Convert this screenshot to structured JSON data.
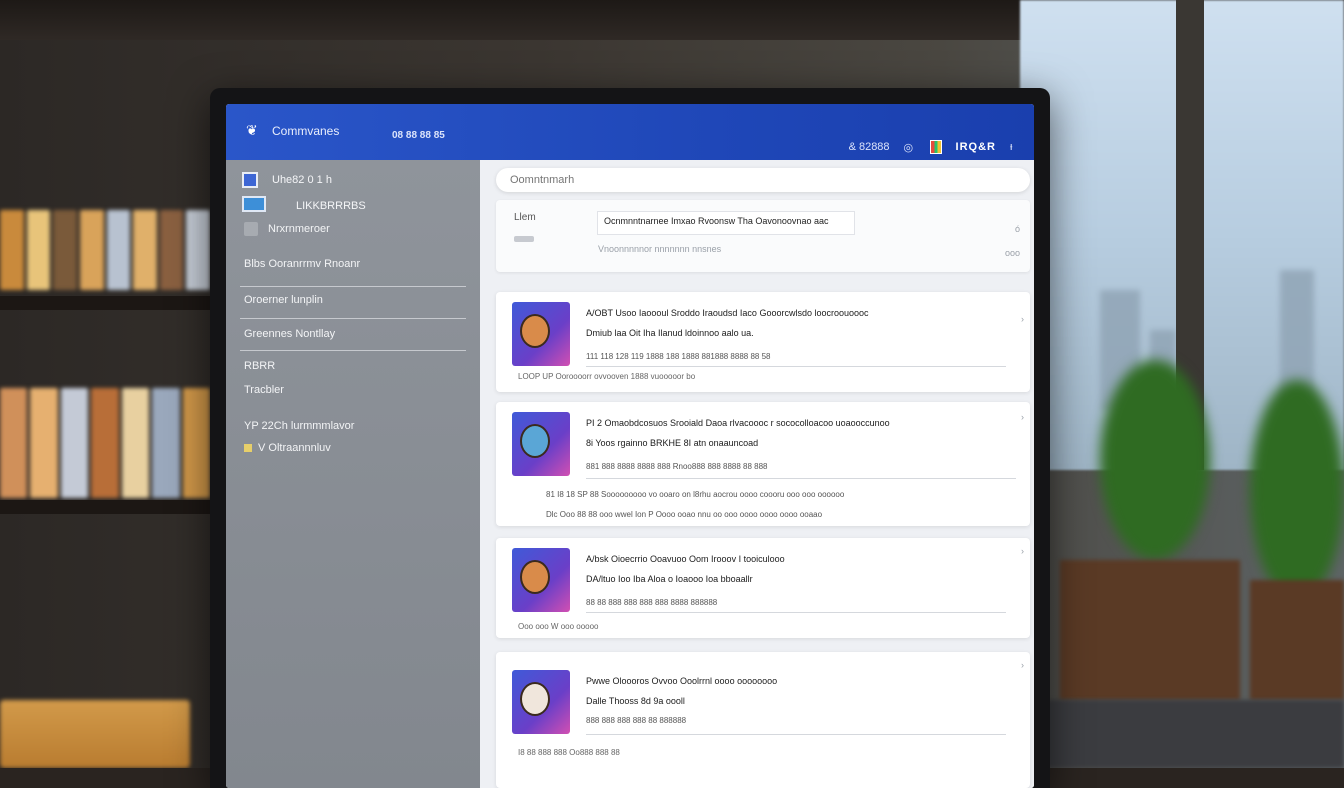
{
  "app": {
    "title": "Commvanes",
    "meta": "08 88 88 85",
    "user_label": "IRQ&R",
    "top_icon_text": "& 82888"
  },
  "sidebar": {
    "header": "Uhe82 0 1 h",
    "sub": "LIKKBRRRBS",
    "search_label": "Nrxrnmeroer",
    "items": [
      {
        "label": "Blbs      Ooranrrmv Rnoanr"
      },
      {
        "label": "Oroerner lunplin"
      },
      {
        "label": "Greennes Nontllay"
      },
      {
        "label": "RBRR"
      },
      {
        "label": "Tracbler"
      },
      {
        "label": "YP 22Ch lurmmmlavor"
      },
      {
        "label": "V Oltraannnluv"
      }
    ]
  },
  "main": {
    "search_placeholder": "Oomntnmarh",
    "compose": {
      "label": "Llem",
      "text": "Ocnmnntnarnee Imxao Rvoonsw Tha Oavonoovnao aac",
      "hint": "Vnoonnnnnor nnnnnnn nnsnes",
      "more": "ó",
      "more2": "ooo"
    },
    "posts": [
      {
        "title": "A/OBT Usoo Iaoooul Sroddo Iraoudsd Iaco Gooorcwlsdo loocroouoooc",
        "sub": "Dmiub laa Oit Iha Ilanud ldoinnoo aalo ua.",
        "meta": "111 118 128 119 1888 188 1888 881888 8888 88 58",
        "foot": "LOOP    UP    Ooroooorr ovvooven 1888 vuooooor bo",
        "chev": "›"
      },
      {
        "title": "PI 2 Omaobdcosuos Srooiald Daoa rlvacoooc r sococolloacoo uoaooccunoo",
        "sub": "8i Yoos rgainno BRKHE 8I atn onaauncoad",
        "meta": "881 888 8888 8888 888 Rnoo888 888 8888 88 888",
        "foot": "81 I8 18 SP 88 Sooooooooo vo ooaro on l8rhu aocrou oooo coooru ooo ooo oooooo",
        "foot2": "Dlc Ooo 88 88 ooo wwel Ion P Oooo ooao nnu oo ooo oooo oooo oooo ooaao",
        "chev": "›"
      },
      {
        "title": "A/bsk Oioecrrio Ooavuoo Oom Irooov I tooiculooo",
        "sub": "DA/ltuo Ioo Iba Aloa o Ioaooo Ioa bboaallr",
        "meta": "88 88 888 888 888 888 8888 888888",
        "foot": "Ooo ooo W ooo ooooo",
        "chev": "›"
      },
      {
        "title": "Pwwe Oloooros Ovvoo Ooolrrnl oooo oooooooo",
        "sub": "Dalle Thooss 8d 9a oooll",
        "meta": "888 888 888 888 88 888888",
        "foot": "I8  88  888 888 Oo888 888 88",
        "chev": "›"
      }
    ]
  }
}
